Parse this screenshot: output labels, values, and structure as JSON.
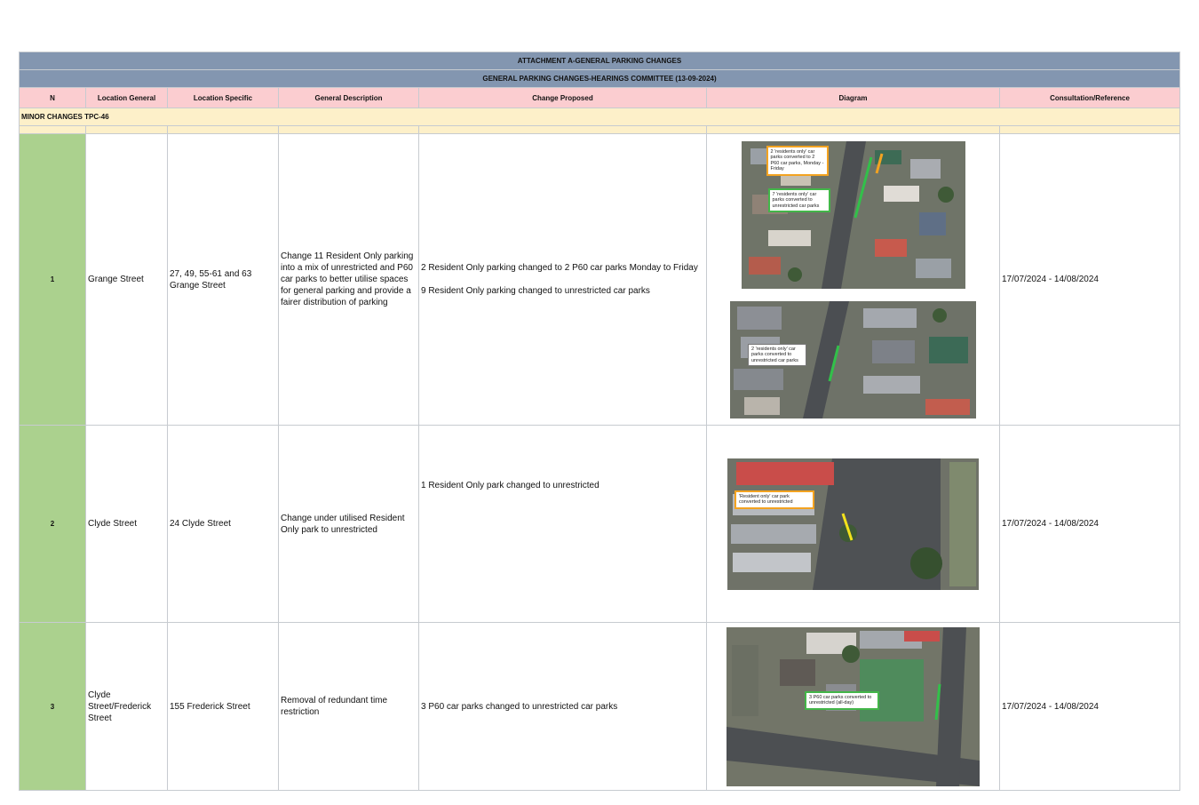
{
  "title": "ATTACHMENT A-GENERAL PARKING CHANGES",
  "subtitle": "GENERAL PARKING CHANGES-HEARINGS COMMITTEE (13-09-2024)",
  "columns": [
    "N",
    "Location General",
    "Location Specific",
    "General Description",
    "Change Proposed",
    "Diagram",
    "Consultation/Reference"
  ],
  "section": "MINOR CHANGES TPC-46",
  "rows": [
    {
      "n": "1",
      "location_general": "Grange Street",
      "location_specific": "27, 49, 55-61 and 63 Grange Street",
      "general_description": "Change 11 Resident Only parking into a mix of unrestricted and P60 car parks to better utilise spaces for general parking and provide a fairer distribution of parking",
      "change_proposed": [
        "2 Resident Only parking changed to 2 P60 car parks Monday to Friday",
        "9 Resident Only parking changed to unrestricted car parks"
      ],
      "diagram_notes": [
        "2 'residents only' car parks converted to 2 P60 car parks, Monday - Friday",
        "7 'residents only' car parks converted to unrestricted car parks",
        "2 'residents only' car parks converted to unrestricted car parks"
      ],
      "consultation": "17/07/2024 - 14/08/2024"
    },
    {
      "n": "2",
      "location_general": "Clyde Street",
      "location_specific": "24 Clyde Street",
      "general_description": "Change under utilised Resident Only park to unrestricted",
      "change_proposed": [
        "1 Resident Only park changed to unrestricted"
      ],
      "diagram_notes": [
        "'Resident only' car park converted to unrestricted"
      ],
      "consultation": "17/07/2024 - 14/08/2024"
    },
    {
      "n": "3",
      "location_general": "Clyde Street/Frederick Street",
      "location_specific": "155 Frederick Street",
      "general_description": "Removal of redundant time restriction",
      "change_proposed": [
        "3 P60 car parks changed to unrestricted car parks"
      ],
      "diagram_notes": [
        "3 P60 car parks converted to unrestricted (all-day)"
      ],
      "consultation": "17/07/2024 - 14/08/2024"
    }
  ],
  "colors": {
    "title_band": "#8396b0",
    "header_row": "#fbcdd0",
    "section_row": "#fdf0c9",
    "number_cell": "#abd18e",
    "note_amber": "#f3a321",
    "note_green": "#43b649"
  }
}
